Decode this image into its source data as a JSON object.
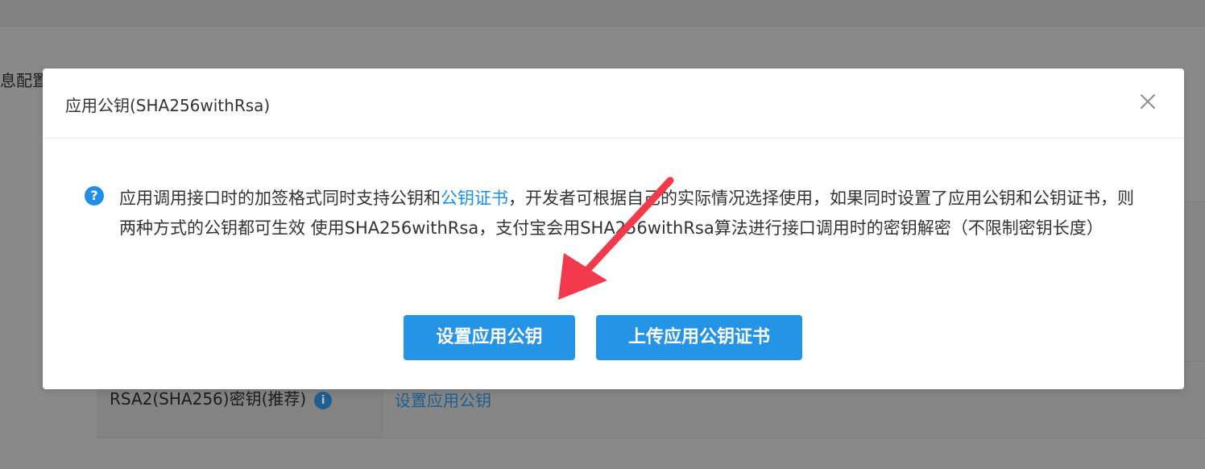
{
  "background": {
    "section_title": "息配置",
    "row_label": "RSA2(SHA256)密钥(推荐)",
    "row_info_icon": "i",
    "row_link": "设置应用公钥"
  },
  "modal": {
    "title": "应用公钥(SHA256withRsa)",
    "close_icon": "close-icon",
    "help_icon": "?",
    "description": {
      "before_link": "应用调用接口时的加签格式同时支持公钥和",
      "link": "公钥证书",
      "after_link": "，开发者可根据自己的实际情况选择使用，如果同时设置了应用公钥和公钥证书，则两种方式的公钥都可生效 使用SHA256withRsa，支付宝会用SHA256withRsa算法进行接口调用时的密钥解密（不限制密钥长度）"
    },
    "buttons": {
      "set_public_key": "设置应用公钥",
      "upload_certificate": "上传应用公钥证书"
    }
  },
  "colors": {
    "primary": "#2593e6",
    "link": "#1f8ee6",
    "overlay": "#8a8a8a",
    "arrow": "#f23a4c"
  }
}
